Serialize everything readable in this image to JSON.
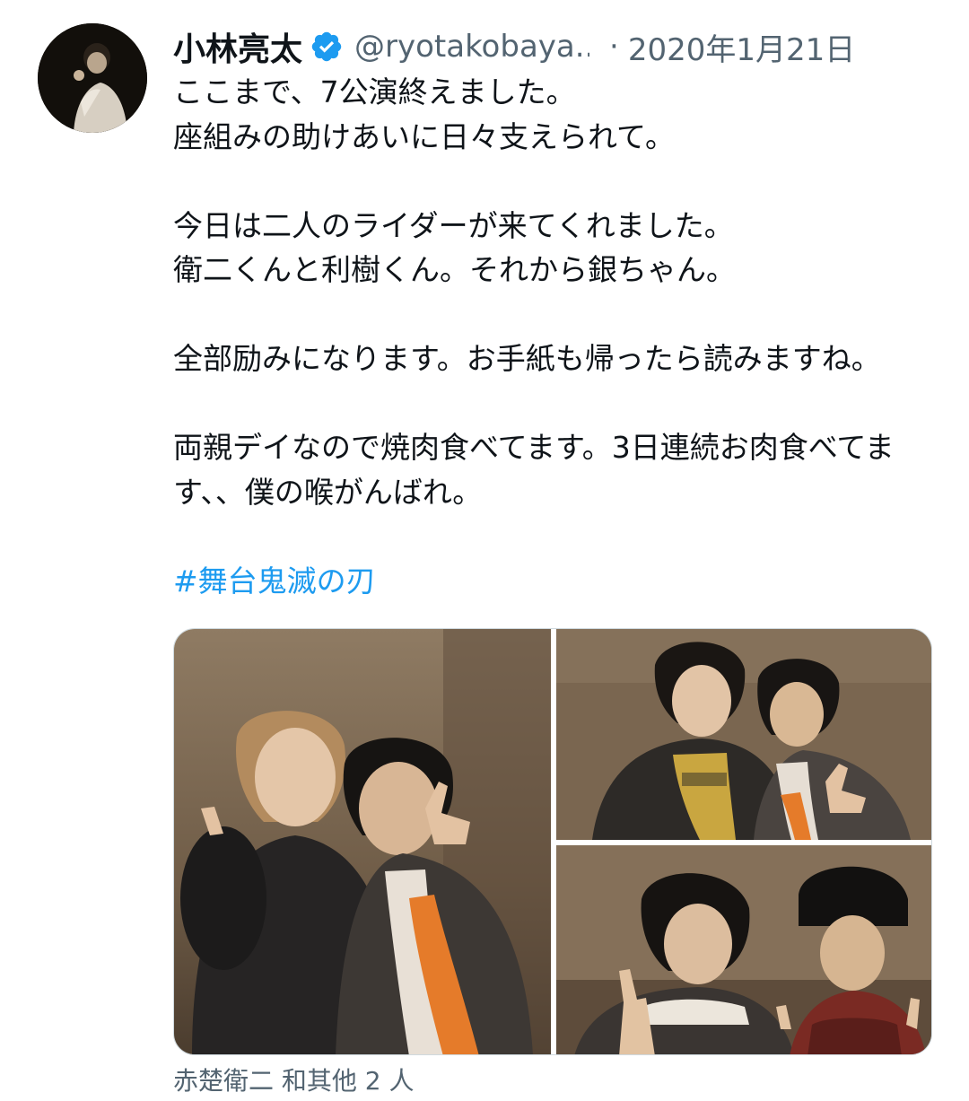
{
  "tweet": {
    "author": {
      "display_name": "小林亮太",
      "handle": "@ryotakobaya...",
      "verified_icon": "verified-badge-icon",
      "avatar_icon": "user-avatar"
    },
    "separator": "·",
    "timestamp": "2020年1月21日",
    "lines": [
      "ここまで、7公演終えました。",
      "座組みの助けあいに日々支えられて。",
      "",
      "今日は二人のライダーが来てくれました。",
      "衛二くんと利樹くん。それから銀ちゃん。",
      "",
      "全部励みになります。お手紙も帰ったら読みますね。",
      "",
      "両親デイなので焼肉食べてます。3日連続お肉食べてま",
      "す、、僕の喉がんばれ。",
      ""
    ],
    "hashtag": "#舞台鬼滅の刃",
    "media": {
      "photos": [
        "photo-1",
        "photo-2",
        "photo-3"
      ]
    },
    "tagged_people": "赤楚衛二 和其他 2 人"
  },
  "colors": {
    "text": "#0f1419",
    "secondary": "#536471",
    "link": "#1d9bf0",
    "verified": "#1d9bf0",
    "border": "#cfd9de"
  }
}
